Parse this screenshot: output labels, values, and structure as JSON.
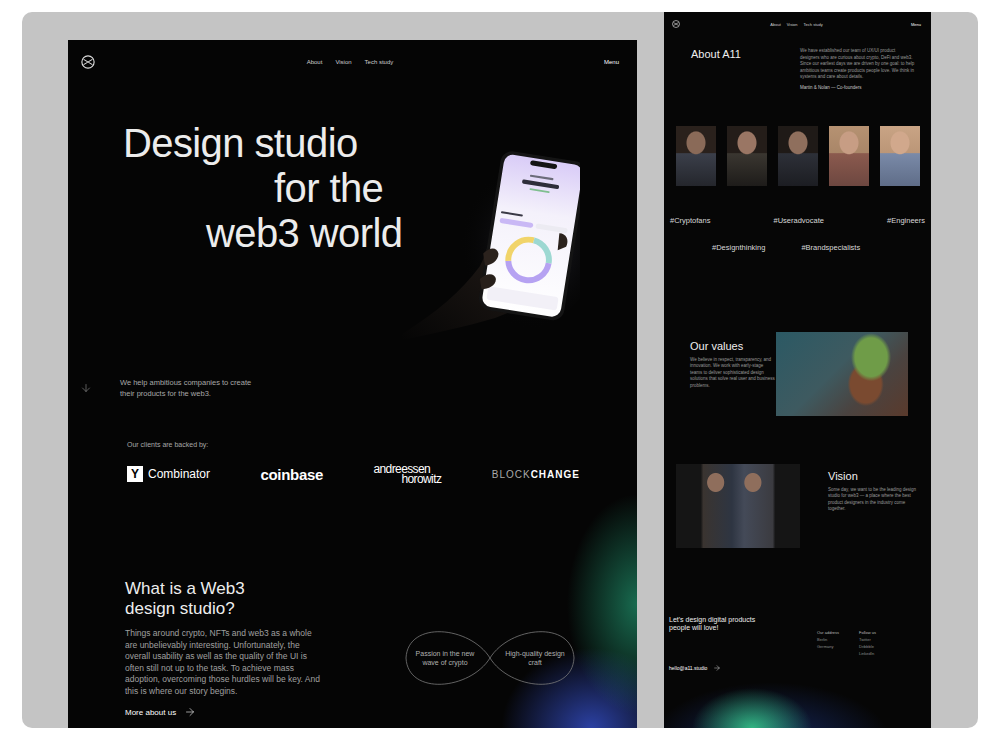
{
  "left_page": {
    "nav": {
      "links": [
        "About",
        "Vision",
        "Tech study"
      ],
      "menu": "Menu"
    },
    "hero": {
      "lines": [
        "Design studio",
        "for the",
        "web3 world"
      ]
    },
    "tagline": "We help ambitious companies to create their products for the web3.",
    "clients": {
      "label": "Our clients are backed by:",
      "logos": [
        {
          "kind": "yc",
          "mark": "Y",
          "text": "Combinator"
        },
        {
          "kind": "coinbase",
          "text": "coinbase"
        },
        {
          "kind": "a16z",
          "lines": [
            "andreessen",
            "horowitz"
          ]
        },
        {
          "kind": "blockchange",
          "light": "BLOCK",
          "bold": "CHANGE"
        }
      ]
    },
    "about": {
      "title_lines": [
        "What is a Web3",
        "design studio?"
      ],
      "body": "Things around crypto, NFTs and web3 as a whole are unbelievably interesting. Unfortunately, the overall usability as well as the quality of the UI is often still not up to the task. To achieve mass adoption, overcoming those hurdles will be key. And this is where our story begins.",
      "link": "More about us"
    },
    "infinity": {
      "left": "Passion in the new wave of crypto",
      "right": "High-quality design craft"
    }
  },
  "right_page": {
    "nav": {
      "links": [
        "About",
        "Vision",
        "Tech study"
      ],
      "menu": "Menu"
    },
    "about": {
      "title": "About A11",
      "body": "We have established our team of UX/UI product designers who are curious about crypto, DeFi and web3. Since our earliest days we are driven by one goal: to help ambitious teams create products people love. We think in systems and care about details.",
      "credit": "Martin & Nolan — Co-founders"
    },
    "hashtags": [
      [
        "#Cryptofans",
        "#Useradvocate",
        "#Engineers"
      ],
      [
        "#Designthinking",
        "#Brandspecialists"
      ]
    ],
    "values": {
      "title": "Our values",
      "body": "We believe in respect, transparency, and innovation. We work with early-stage teams to deliver sophisticated design solutions that solve real user and business problems."
    },
    "vision": {
      "title": "Vision",
      "body": "Some day, we want to be the leading design studio for web3 — a place where the best product designers in the industry come together."
    },
    "footer": {
      "title": "Let's design digital products people will love!",
      "email": "hello@a11.studio",
      "columns": [
        {
          "heading": "Our address",
          "lines": [
            "Berlin",
            "Germany"
          ]
        },
        {
          "heading": "Follow us",
          "lines": [
            "Twitter",
            "Dribbble",
            "LinkedIn"
          ]
        }
      ]
    }
  }
}
